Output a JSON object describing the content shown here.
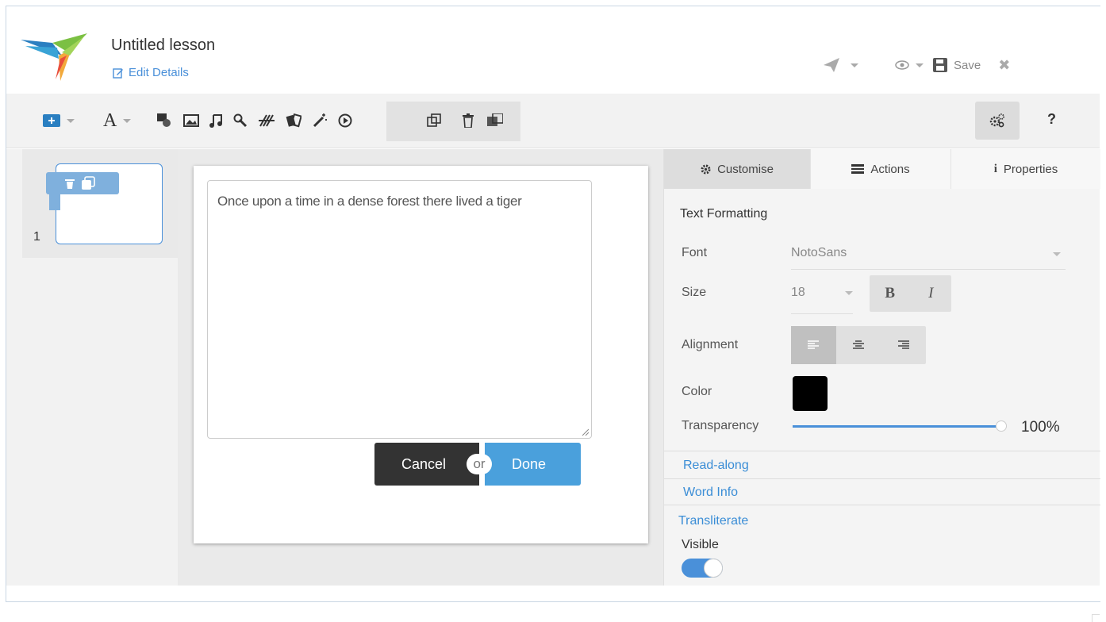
{
  "header": {
    "title": "Untitled lesson",
    "edit_label": "Edit Details",
    "save_label": "Save"
  },
  "slides": {
    "items": [
      {
        "number": "1"
      }
    ]
  },
  "editor": {
    "text": "Once upon a time in a dense forest there lived a tiger",
    "cancel_label": "Cancel",
    "or_label": "or",
    "done_label": "Done"
  },
  "panel": {
    "tabs": [
      {
        "label": "Customise",
        "icon": "gear-icon",
        "active": true
      },
      {
        "label": "Actions",
        "icon": "list-icon"
      },
      {
        "label": "Properties",
        "icon": "info-icon"
      }
    ],
    "section_title": "Text Formatting",
    "font_label": "Font",
    "font_value": "NotoSans",
    "size_label": "Size",
    "size_value": "18",
    "bold_label": "B",
    "italic_label": "I",
    "alignment_label": "Alignment",
    "alignment_value": "left",
    "color_label": "Color",
    "color_value": "#000000",
    "transparency_label": "Transparency",
    "transparency_value": "100%",
    "links": [
      "Read-along",
      "Word Info",
      "Transliterate"
    ],
    "visible_label": "Visible",
    "visible_on": true
  },
  "colors": {
    "accent": "#4a90d9",
    "done": "#4aa0dc",
    "cancel": "#333333"
  }
}
